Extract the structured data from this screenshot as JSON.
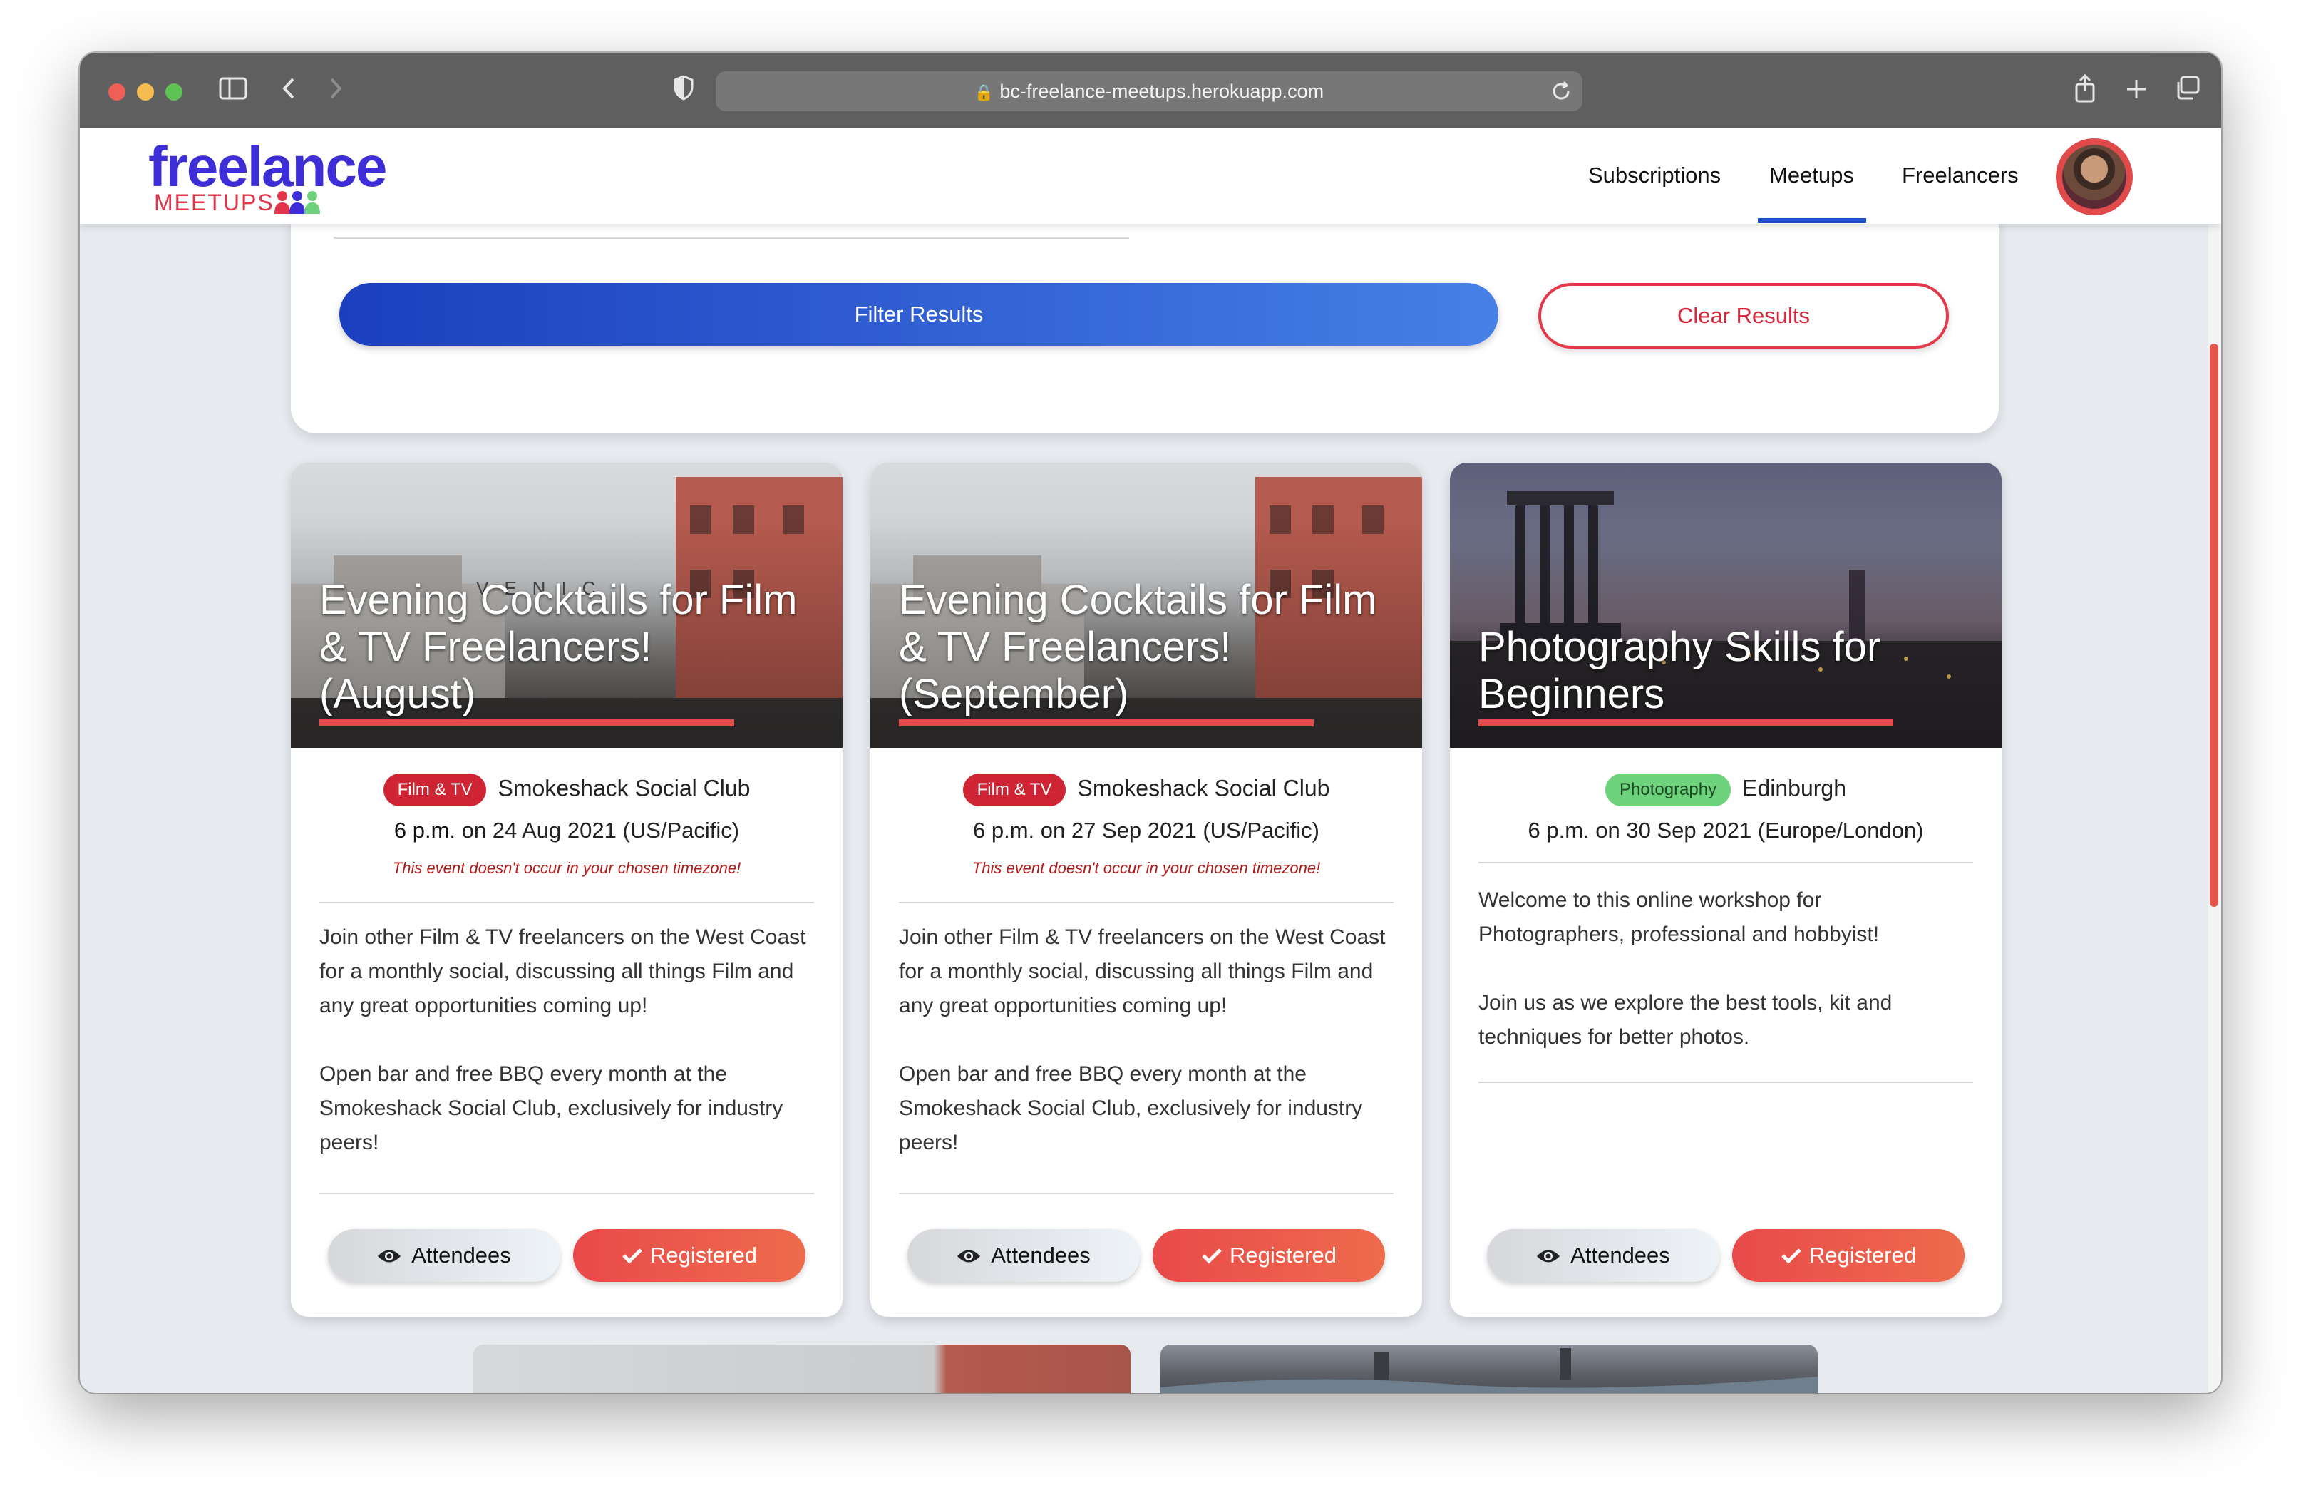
{
  "browser": {
    "url": "bc-freelance-meetups.herokuapp.com"
  },
  "header": {
    "logo_main": "freelance",
    "logo_sub": "MEETUPS",
    "nav": [
      "Subscriptions",
      "Meetups",
      "Freelancers"
    ],
    "active_nav": "Meetups"
  },
  "filter": {
    "filter_label": "Filter Results",
    "clear_label": "Clear Results"
  },
  "cards": [
    {
      "title": "Evening Cocktails for Film & TV Freelancers! (August)",
      "category": "Film & TV",
      "location": "Smokeshack Social Club",
      "time": "6 p.m.",
      "on": "on",
      "date": "24 Aug 2021",
      "timezone": "(US/Pacific)",
      "warning": "This event doesn't occur in your chosen timezone!",
      "description": [
        "Join other Film & TV freelancers on the West Coast for a monthly social, discussing all things Film and any great opportunities coming up!",
        "Open bar and free BBQ every month at the Smokeshack Social Club, exclusively for industry peers!"
      ],
      "attendees_label": "Attendees",
      "registered_label": "Registered"
    },
    {
      "title": "Evening Cocktails for Film & TV Freelancers! (September)",
      "category": "Film & TV",
      "location": "Smokeshack Social Club",
      "time": "6 p.m.",
      "on": "on",
      "date": "27 Sep 2021",
      "timezone": "(US/Pacific)",
      "warning": "This event doesn't occur in your chosen timezone!",
      "description": [
        "Join other Film & TV freelancers on the West Coast for a monthly social, discussing all things Film and any great opportunities coming up!",
        "Open bar and free BBQ every month at the Smokeshack Social Club, exclusively for industry peers!"
      ],
      "attendees_label": "Attendees",
      "registered_label": "Registered"
    },
    {
      "title": "Photography Skills for Beginners",
      "category": "Photography",
      "location": "Edinburgh",
      "time": "6 p.m.",
      "on": "on",
      "date": "30 Sep 2021",
      "timezone": "(Europe/London)",
      "description": [
        "Welcome to this online workshop for Photographers, professional and hobbyist!",
        "Join us as we explore the best tools, kit and techniques for better photos."
      ],
      "attendees_label": "Attendees",
      "registered_label": "Registered"
    }
  ],
  "colors": {
    "brand_purple": "#3d2ed8",
    "brand_red": "#e3354a",
    "nav_active": "#1f4fc7",
    "filter_button": "#2a5bd8",
    "registered_button": "#e84a4a",
    "badge_film": "#cf2433",
    "badge_photo": "#6ed27c"
  }
}
